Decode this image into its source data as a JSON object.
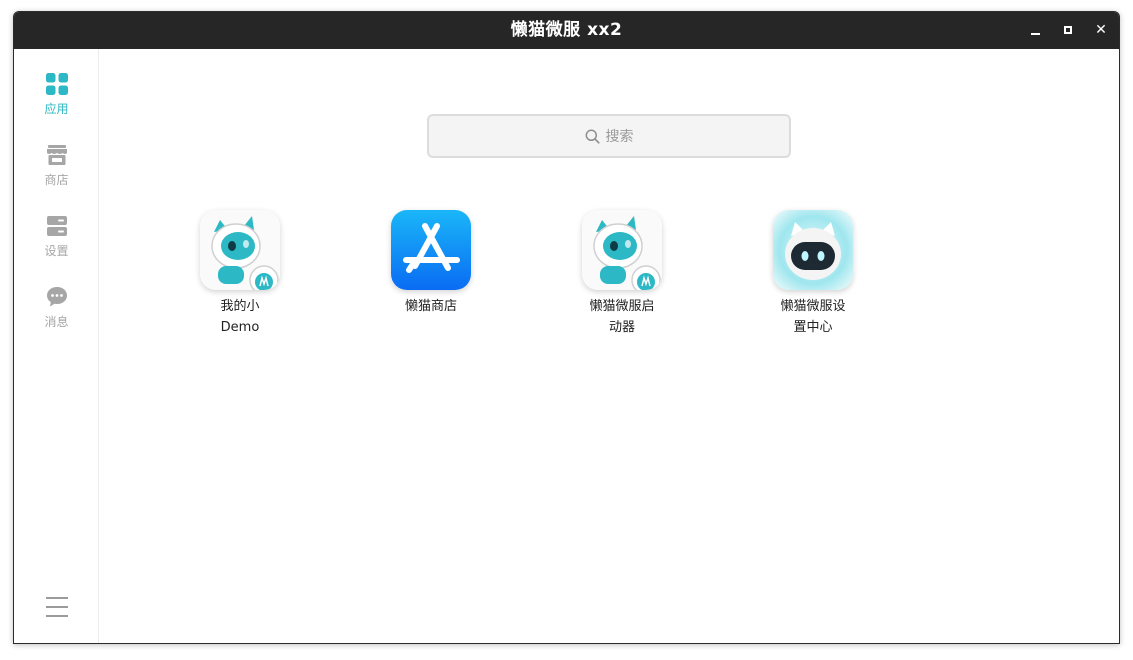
{
  "window": {
    "title": "懒猫微服 xx2",
    "controls": [
      "minimize",
      "maximize",
      "close"
    ]
  },
  "sidebar": {
    "items": [
      {
        "label": "应用",
        "icon": "apps-grid-icon",
        "active": true
      },
      {
        "label": "商店",
        "icon": "store-icon",
        "active": false
      },
      {
        "label": "设置",
        "icon": "settings-icon",
        "active": false
      },
      {
        "label": "消息",
        "icon": "message-icon",
        "active": false
      }
    ],
    "menu_icon": "menu-icon"
  },
  "search": {
    "placeholder": "搜索",
    "icon": "search-icon"
  },
  "apps": [
    {
      "name_line1": "我的小",
      "name_line2": "Demo",
      "icon": "cat-astronaut-icon"
    },
    {
      "name_line1": "懒猫商店",
      "name_line2": "",
      "icon": "app-store-icon"
    },
    {
      "name_line1": "懒猫微服启",
      "name_line2": "动器",
      "icon": "cat-astronaut-icon"
    },
    {
      "name_line1": "懒猫微服设",
      "name_line2": "置中心",
      "icon": "robot-cat-icon"
    }
  ],
  "colors": {
    "accent": "#2cb8c4",
    "titlebar": "#262626",
    "inactive_nav": "#a6a6a6",
    "store_blue": "#0a84ff"
  }
}
